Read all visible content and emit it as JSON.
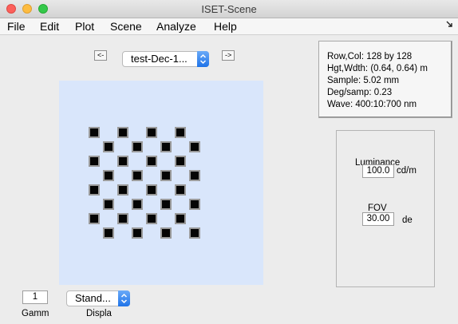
{
  "window": {
    "title": "ISET-Scene"
  },
  "menu": [
    "File",
    "Edit",
    "Plot",
    "Scene",
    "Analyze",
    "Help"
  ],
  "menu_corner_icon": "arrow-icon",
  "nav": {
    "prev": "<-",
    "next": "->",
    "scene_select": "test-Dec-1..."
  },
  "info": {
    "rowcol": "Row,Col: 128 by 128",
    "hgtwdth": "Hgt,Wdth: (0.64, 0.64) m",
    "sample": "Sample: 5.02 mm",
    "degsamp": "Deg/samp: 0.23",
    "wave": "Wave: 400:10:700 nm"
  },
  "luminance": {
    "label": "Luminance",
    "value": "100.0",
    "unit": "cd/m"
  },
  "fov": {
    "label": "FOV",
    "value": "30.00",
    "unit": "de"
  },
  "gamma": {
    "value": "1",
    "label": "Gamm"
  },
  "display": {
    "select": "Stand...",
    "label": "Displa"
  },
  "colors": {
    "canvas_bg": "#d9e6fb",
    "checker_dark": "#050505",
    "popup_accent": "#1f73e8"
  }
}
